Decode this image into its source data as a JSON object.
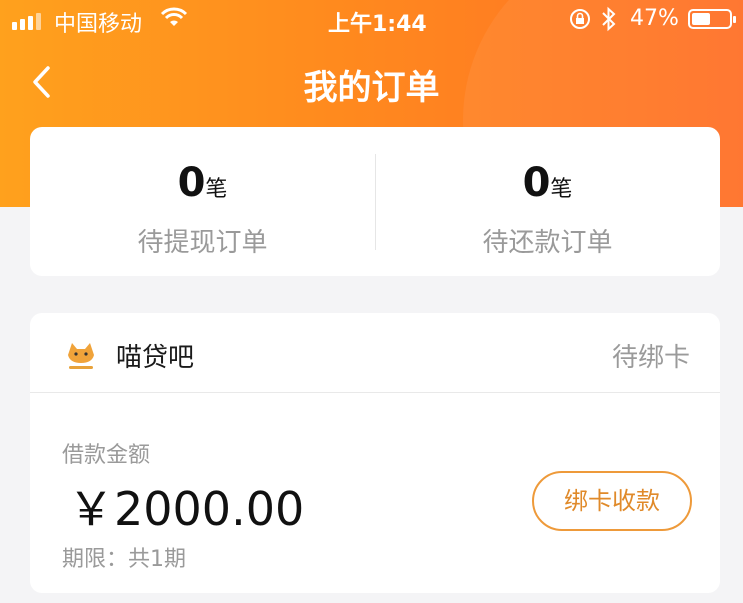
{
  "status_bar": {
    "carrier": "中国移动",
    "time": "上午1:44",
    "battery_percent": "47%",
    "battery_level": 0.47,
    "icons": [
      "signal-icon",
      "wifi-icon",
      "rotation-lock-icon",
      "bluetooth-icon",
      "battery-icon"
    ]
  },
  "header": {
    "title": "我的订单",
    "back_icon": "chevron-left-icon"
  },
  "summary": {
    "pending_withdraw": {
      "count": "0",
      "unit": "笔",
      "label": "待提现订单"
    },
    "pending_repay": {
      "count": "0",
      "unit": "笔",
      "label": "待还款订单"
    }
  },
  "order": {
    "merchant_name": "喵贷吧",
    "merchant_logo_icon": "cat-logo-icon",
    "status": "待绑卡",
    "amount_label": "借款金额",
    "amount": "￥2000.00",
    "term": "期限：共1期",
    "action_label": "绑卡收款"
  },
  "colors": {
    "header_gradient_start": "#ffa11d",
    "header_gradient_end": "#ff6f26",
    "accent_button": "#ee9a3a",
    "background": "#f4f4f6"
  }
}
